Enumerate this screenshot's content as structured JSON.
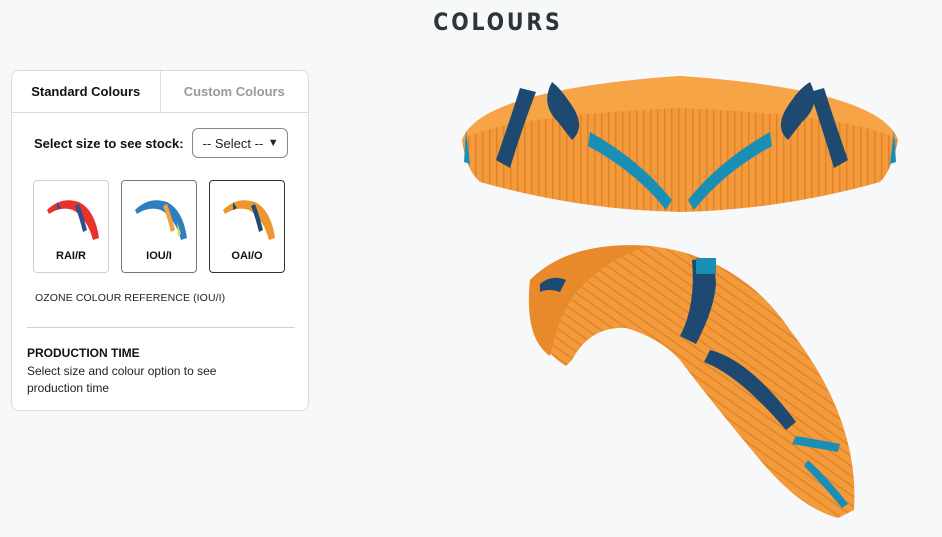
{
  "page": {
    "title": "COLOURS"
  },
  "tabs": [
    {
      "label": "Standard Colours",
      "active": true
    },
    {
      "label": "Custom Colours",
      "active": false
    }
  ],
  "size": {
    "label": "Select size to see stock:",
    "selected": "-- Select --"
  },
  "swatches": [
    {
      "label": "RAI/R",
      "colors": {
        "main": "#e8322a",
        "accent": "#2f4f8f"
      }
    },
    {
      "label": "IOU/I",
      "colors": {
        "main": "#2f7fc0",
        "accent": "#f0a040"
      }
    },
    {
      "label": "OAI/O",
      "colors": {
        "main": "#f0962e",
        "accent": "#1f4d7a"
      }
    }
  ],
  "colour_reference": "OZONE COLOUR REFERENCE (IOU/I)",
  "production": {
    "title": "PRODUCTION TIME",
    "text": "Select size and colour option to see production time"
  },
  "wing_colors": {
    "orange": "#f39a3a",
    "navy": "#1e4a72",
    "teal": "#1a8fb5"
  }
}
